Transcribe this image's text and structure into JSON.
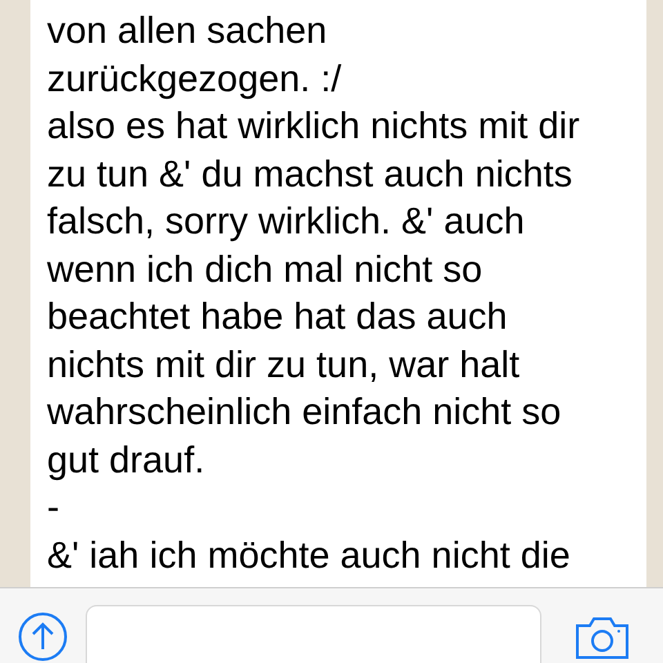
{
  "message": {
    "lines": [
      "von allen sachen",
      "zurückgezogen. :/",
      "also es hat wirklich nichts mit dir",
      "zu tun &' du machst auch nichts",
      "falsch, sorry wirklich. &' auch",
      "wenn ich dich mal nicht so",
      "beachtet habe hat das auch",
      "nichts mit dir zu tun, war halt",
      "wahrscheinlich einfach nicht so",
      "gut drauf.",
      "-",
      "&' iah ich möchte auch nicht die"
    ]
  }
}
